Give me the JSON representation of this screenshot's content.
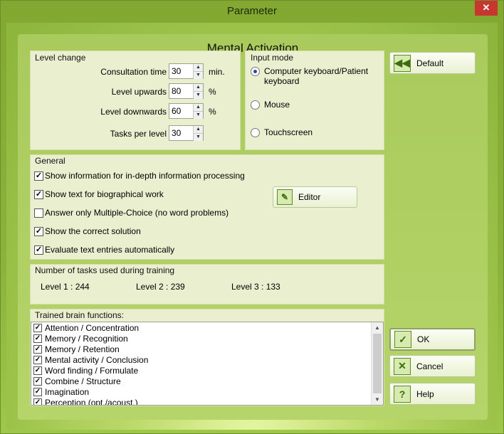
{
  "window": {
    "title": "Parameter",
    "close_glyph": "✕"
  },
  "main_title": "Mental Activation",
  "level_change": {
    "label": "Level change",
    "fields": [
      {
        "label": "Consultation time",
        "value": "30",
        "unit": "min."
      },
      {
        "label": "Level upwards",
        "value": "80",
        "unit": "%"
      },
      {
        "label": "Level downwards",
        "value": "60",
        "unit": "%"
      },
      {
        "label": "Tasks per level",
        "value": "30",
        "unit": ""
      }
    ]
  },
  "input_mode": {
    "label": "Input mode",
    "options": [
      {
        "label": "Computer keyboard/Patient keyboard",
        "selected": true
      },
      {
        "label": "Mouse",
        "selected": false
      },
      {
        "label": "Touchscreen",
        "selected": false
      }
    ]
  },
  "general": {
    "label": "General",
    "options": [
      {
        "label": "Show information for in-depth information processing",
        "checked": true
      },
      {
        "label": "Show text for biographical work",
        "checked": true
      },
      {
        "label": "Answer only Multiple-Choice (no word problems)",
        "checked": false
      },
      {
        "label": "Show the correct solution",
        "checked": true
      },
      {
        "label": "Evaluate text entries automatically",
        "checked": true
      }
    ],
    "editor_label": "Editor"
  },
  "tasks": {
    "label": "Number of tasks used during training",
    "levels": [
      "Level 1 : 244",
      "Level 2 : 239",
      "Level 3 : 133"
    ]
  },
  "brain_functions": {
    "label": "Trained brain functions:",
    "items": [
      "Attention / Concentration",
      "Memory / Recognition",
      "Memory / Retention",
      "Mental activity / Conclusion",
      "Word finding / Formulate",
      "Combine / Structure",
      "Imagination",
      "Perception (opt./acoust.)"
    ]
  },
  "buttons": {
    "default_label": "Default",
    "ok_label": "OK",
    "cancel_label": "Cancel",
    "help_label": "Help"
  },
  "colors": {
    "accent_green": "#8bb23a",
    "close_red": "#c7372f",
    "panel_bg": "#e9efcf"
  },
  "icons": {
    "default": "rewind-icon",
    "editor": "edit-note-icon",
    "ok": "checkmark-icon",
    "cancel": "cross-icon",
    "help": "question-mark-icon"
  }
}
